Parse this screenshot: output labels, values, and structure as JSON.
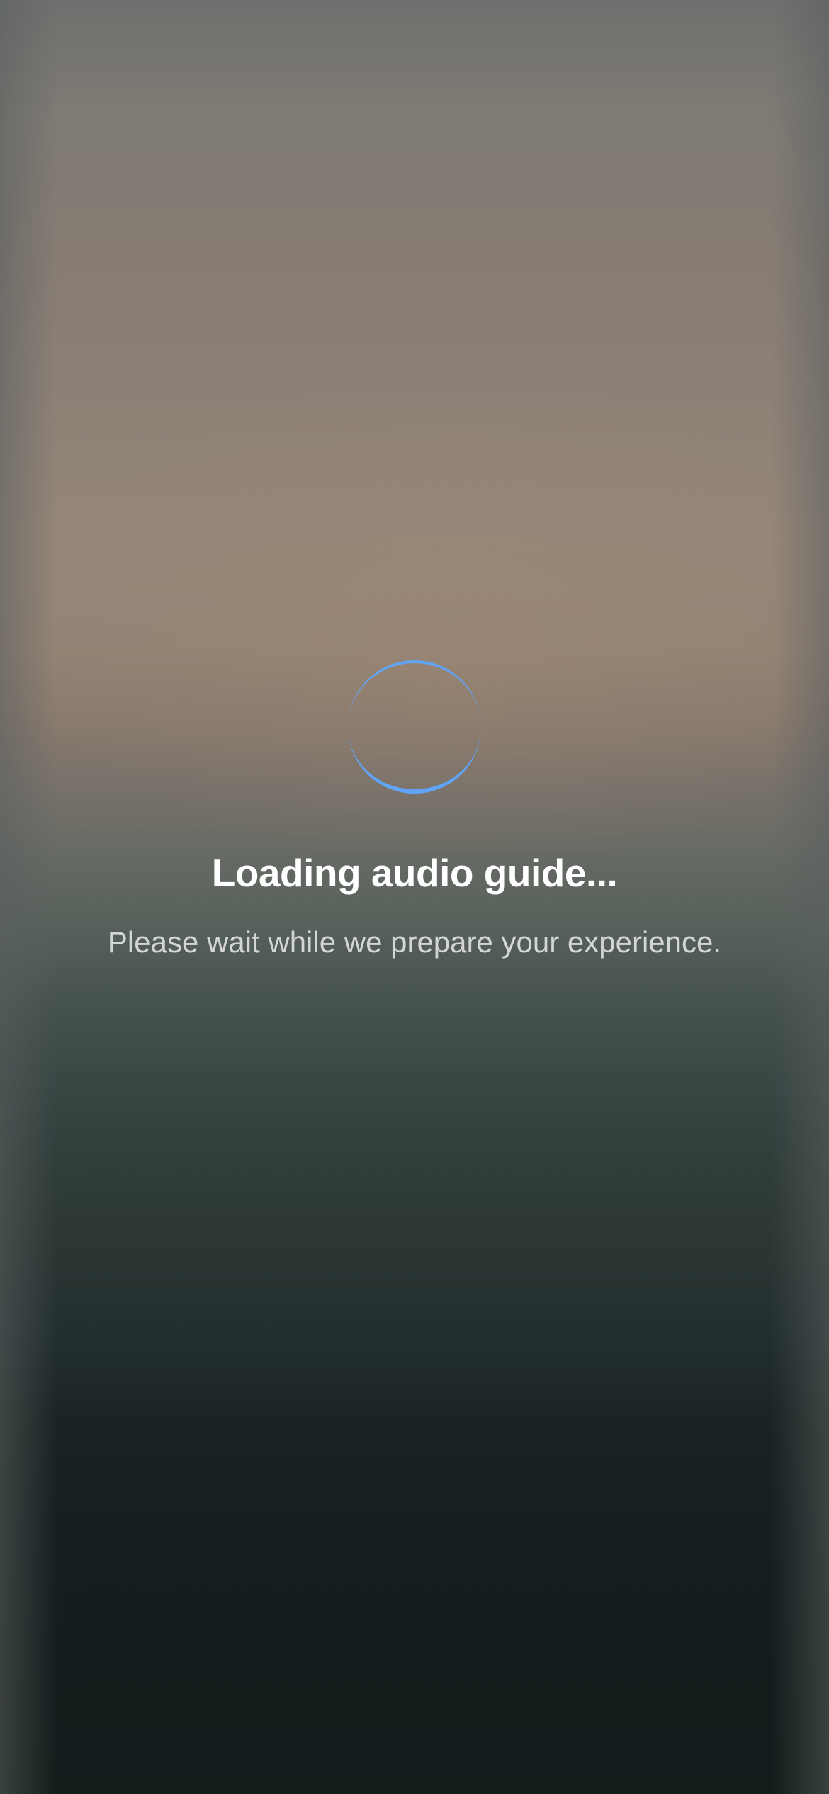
{
  "loading": {
    "title": "Loading audio guide...",
    "message": "Please wait while we prepare your experience.",
    "spinner_icon": "loading-spinner-icon",
    "spinner_color": "#60a5fa"
  },
  "colors": {
    "title": "#ffffff",
    "message": "#d3d5d7",
    "background_top": "#6f706e",
    "background_bottom": "#131b1b"
  }
}
